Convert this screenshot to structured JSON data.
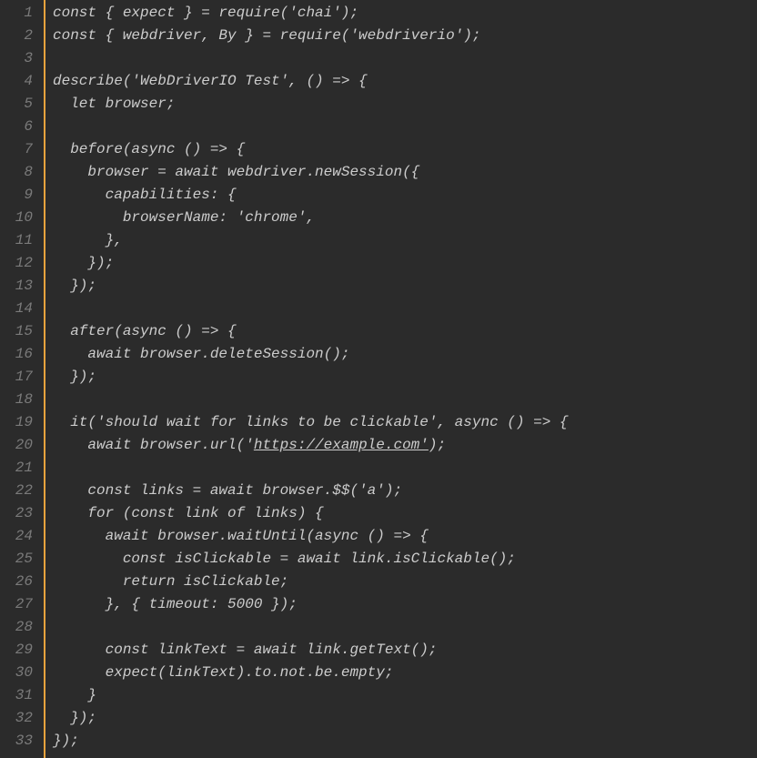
{
  "editor": {
    "lines": [
      "const { expect } = require('chai');",
      "const { webdriver, By } = require('webdriverio');",
      "",
      "describe('WebDriverIO Test', () => {",
      "  let browser;",
      "",
      "  before(async () => {",
      "    browser = await webdriver.newSession({",
      "      capabilities: {",
      "        browserName: 'chrome',",
      "      },",
      "    });",
      "  });",
      "",
      "  after(async () => {",
      "    await browser.deleteSession();",
      "  });",
      "",
      "  it('should wait for links to be clickable', async () => {",
      "    await browser.url('https://example.com');",
      "",
      "    const links = await browser.$$('a');",
      "    for (const link of links) {",
      "      await browser.waitUntil(async () => {",
      "        const isClickable = await link.isClickable();",
      "        return isClickable;",
      "      }, { timeout: 5000 });",
      "",
      "      const linkText = await link.getText();",
      "      expect(linkText).to.not.be.empty;",
      "    }",
      "  });",
      "});"
    ],
    "lineNumbers": [
      "1",
      "2",
      "3",
      "4",
      "5",
      "6",
      "7",
      "8",
      "9",
      "10",
      "11",
      "12",
      "13",
      "14",
      "15",
      "16",
      "17",
      "18",
      "19",
      "20",
      "21",
      "22",
      "23",
      "24",
      "25",
      "26",
      "27",
      "28",
      "29",
      "30",
      "31",
      "32",
      "33"
    ],
    "urlIndex": 19,
    "urlPrefix": "    await browser.url('",
    "urlText": "https://example.com'",
    "urlSuffix": ");"
  }
}
